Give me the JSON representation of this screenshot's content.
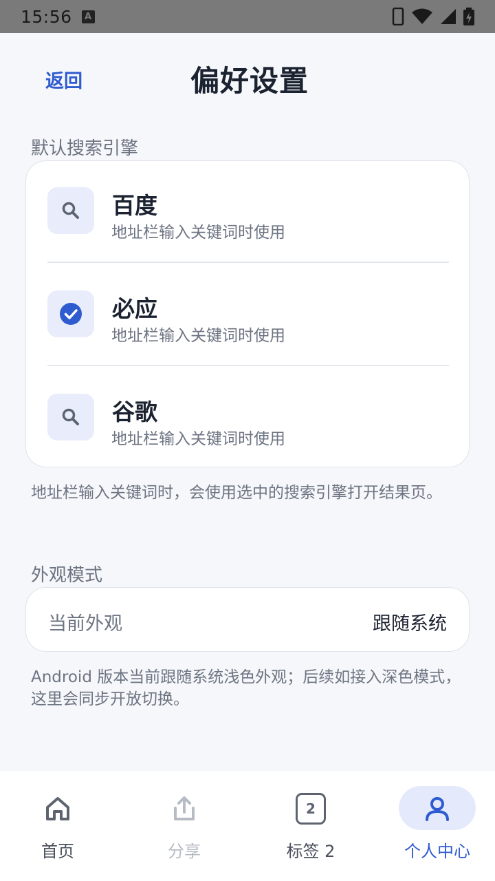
{
  "status_bar": {
    "time": "15:56",
    "notification_letter": "A"
  },
  "header": {
    "back_label": "返回",
    "title": "偏好设置"
  },
  "search_engine": {
    "section_label": "默认搜索引擎",
    "engines": [
      {
        "name": "百度",
        "description": "地址栏输入关键词时使用",
        "icon": "search-icon",
        "selected": false
      },
      {
        "name": "必应",
        "description": "地址栏输入关键词时使用",
        "icon": "check-circle-icon",
        "selected": true
      },
      {
        "name": "谷歌",
        "description": "地址栏输入关键词时使用",
        "icon": "search-icon",
        "selected": false
      }
    ],
    "note": "地址栏输入关键词时，会使用选中的搜索引擎打开结果页。"
  },
  "appearance": {
    "section_label": "外观模式",
    "label": "当前外观",
    "value": "跟随系统",
    "note": "Android 版本当前跟随系统浅色外观；后续如接入深色模式，这里会同步开放切换。"
  },
  "bottom_nav": {
    "items": [
      {
        "label": "首页",
        "icon": "home-icon",
        "active": false,
        "disabled": false
      },
      {
        "label": "分享",
        "icon": "share-icon",
        "active": false,
        "disabled": true
      },
      {
        "label": "标签 2",
        "icon": "tabs-icon",
        "badge": "2",
        "active": false,
        "disabled": false
      },
      {
        "label": "个人中心",
        "icon": "person-icon",
        "active": true,
        "disabled": false
      }
    ]
  },
  "colors": {
    "accent": "#2f5bd0",
    "status_bar": "#7a7a7a",
    "background": "#f6f7fa",
    "card": "#ffffff",
    "icon_tile": "#e8ecfb"
  }
}
